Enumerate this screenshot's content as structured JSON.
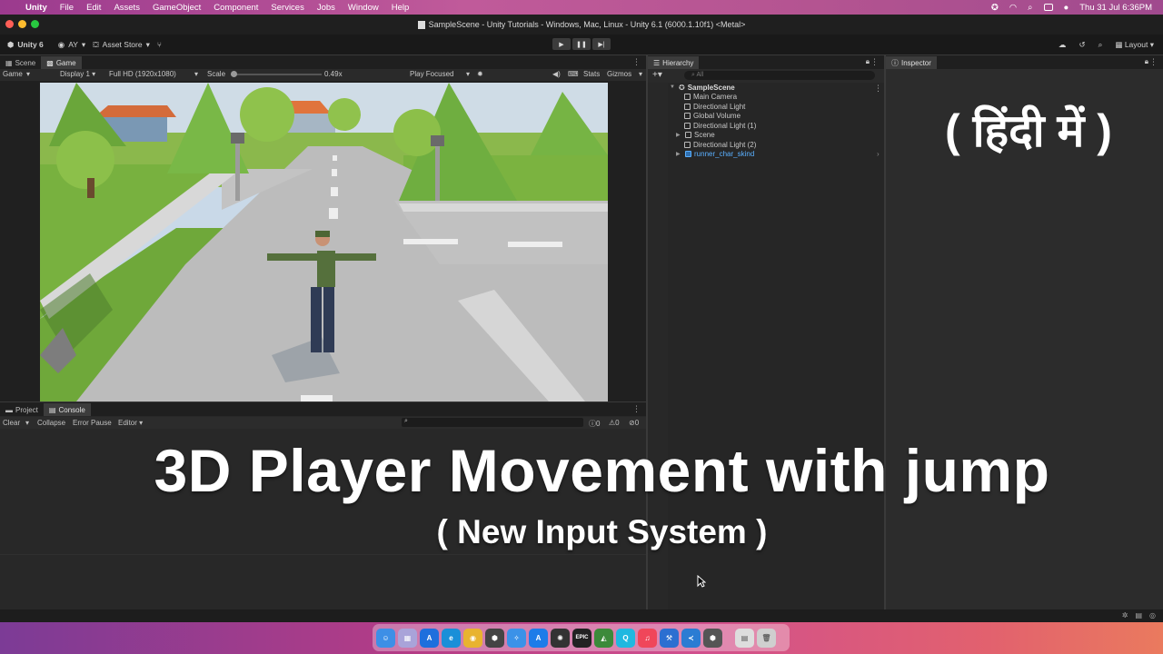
{
  "menubar": {
    "app": "Unity",
    "items": [
      "File",
      "Edit",
      "Assets",
      "GameObject",
      "Component",
      "Services",
      "Jobs",
      "Window",
      "Help"
    ],
    "clock": "Thu 31 Jul  6:36PM"
  },
  "window": {
    "title": "SampleScene - Unity Tutorials - Windows, Mac, Linux - Unity 6.1 (6000.1.10f1) <Metal>"
  },
  "toolbar": {
    "unity_label": "Unity 6",
    "account": "AY",
    "asset_store": "Asset Store",
    "layout": "Layout"
  },
  "scene_tabs": {
    "scene": "Scene",
    "game": "Game"
  },
  "game_bar": {
    "mode": "Game",
    "display": "Display 1",
    "resolution": "Full HD (1920x1080)",
    "scale_label": "Scale",
    "scale_value": "0.49x",
    "play_mode": "Play Focused",
    "stats": "Stats",
    "gizmos": "Gizmos"
  },
  "bottom_tabs": {
    "project": "Project",
    "console": "Console"
  },
  "console_bar": {
    "clear": "Clear",
    "collapse": "Collapse",
    "error_pause": "Error Pause",
    "editor": "Editor",
    "info_count": "0",
    "warn_count": "0",
    "error_count": "0"
  },
  "hierarchy": {
    "tab": "Hierarchy",
    "search_placeholder": "All",
    "scene": "SampleScene",
    "items": [
      {
        "label": "Main Camera"
      },
      {
        "label": "Directional Light"
      },
      {
        "label": "Global Volume"
      },
      {
        "label": "Directional Light (1)"
      },
      {
        "label": "Scene"
      },
      {
        "label": "Directional Light (2)"
      },
      {
        "label": "runner_char_skind"
      }
    ]
  },
  "inspector": {
    "tab": "Inspector"
  },
  "overlay": {
    "hindi": "( हिंदी में )",
    "title": "3D Player Movement with jump",
    "subtitle": "( New Input System )"
  },
  "colors": {
    "menubar": "#b4508f",
    "editor_bg": "#282828",
    "selected_prefab": "#5ab0ff",
    "grass": "#79b23f",
    "road": "#b9b9b9"
  }
}
